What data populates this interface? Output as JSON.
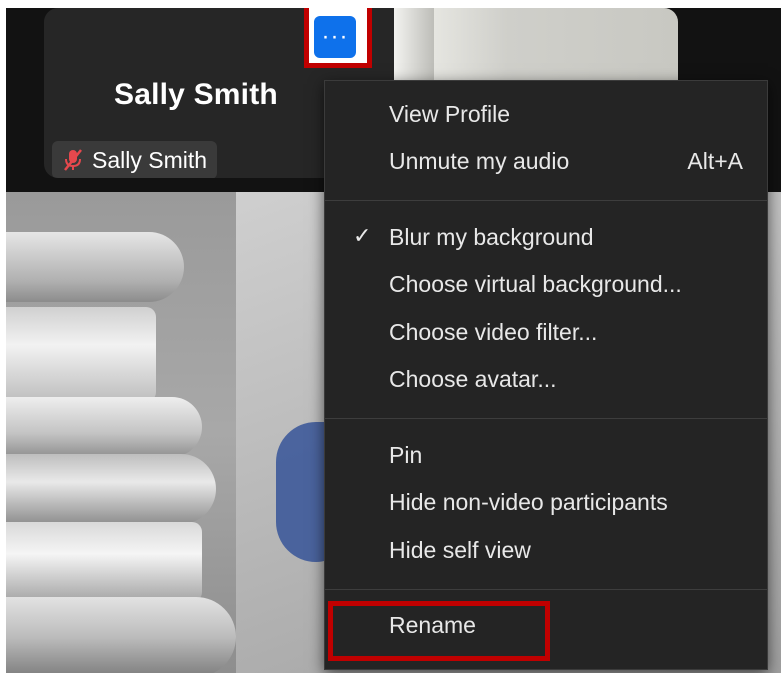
{
  "participant": {
    "display_name": "Sally Smith",
    "badge_name": "Sally Smith"
  },
  "more_button": {
    "label": "···"
  },
  "menu": {
    "groups": [
      [
        {
          "label": "View Profile",
          "shortcut": "",
          "checked": false
        },
        {
          "label": "Unmute my audio",
          "shortcut": "Alt+A",
          "checked": false
        }
      ],
      [
        {
          "label": "Blur my background",
          "shortcut": "",
          "checked": true
        },
        {
          "label": "Choose virtual background...",
          "shortcut": "",
          "checked": false
        },
        {
          "label": "Choose video filter...",
          "shortcut": "",
          "checked": false
        },
        {
          "label": "Choose avatar...",
          "shortcut": "",
          "checked": false
        }
      ],
      [
        {
          "label": "Pin",
          "shortcut": "",
          "checked": false
        },
        {
          "label": "Hide non-video participants",
          "shortcut": "",
          "checked": false
        },
        {
          "label": "Hide self view",
          "shortcut": "",
          "checked": false
        }
      ],
      [
        {
          "label": "Rename",
          "shortcut": "",
          "checked": false
        }
      ]
    ],
    "check_glyph": "✓"
  },
  "colors": {
    "accent_blue": "#0e71eb",
    "highlight_red": "#c00000",
    "menu_bg": "#242424",
    "muted_red": "#e5484d"
  },
  "icons": {
    "mic": "muted-mic-icon",
    "more": "more-dots-icon",
    "check": "checkmark-icon"
  }
}
